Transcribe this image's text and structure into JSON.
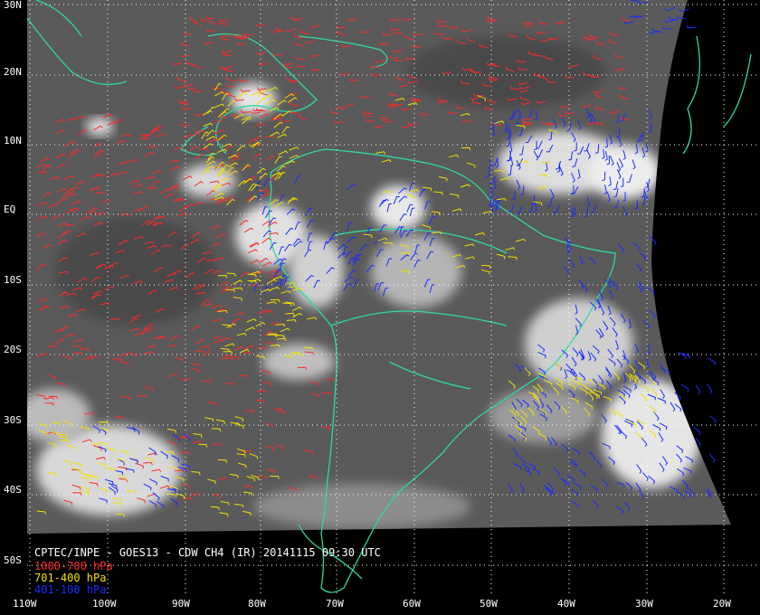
{
  "title": "CPTEC/INPE - GOES13 - CDW CH4 (IR) 20141115 09:30 UTC",
  "legend": [
    {
      "label": "1000-700 hPa",
      "color": "#ff2a2a"
    },
    {
      "label": "701-400 hPa",
      "color": "#f2e200"
    },
    {
      "label": "401-100 hPa",
      "color": "#1a2cff"
    }
  ],
  "lat_labels": [
    "30N",
    "20N",
    "10N",
    "EQ",
    "10S",
    "20S",
    "30S",
    "40S",
    "50S"
  ],
  "lon_labels": [
    "110W",
    "100W",
    "90W",
    "80W",
    "70W",
    "60W",
    "50W",
    "40W",
    "30W",
    "20W"
  ],
  "colors": {
    "background": "#000000",
    "coastline": "#2fd9a0",
    "grid": "#ffffff"
  }
}
